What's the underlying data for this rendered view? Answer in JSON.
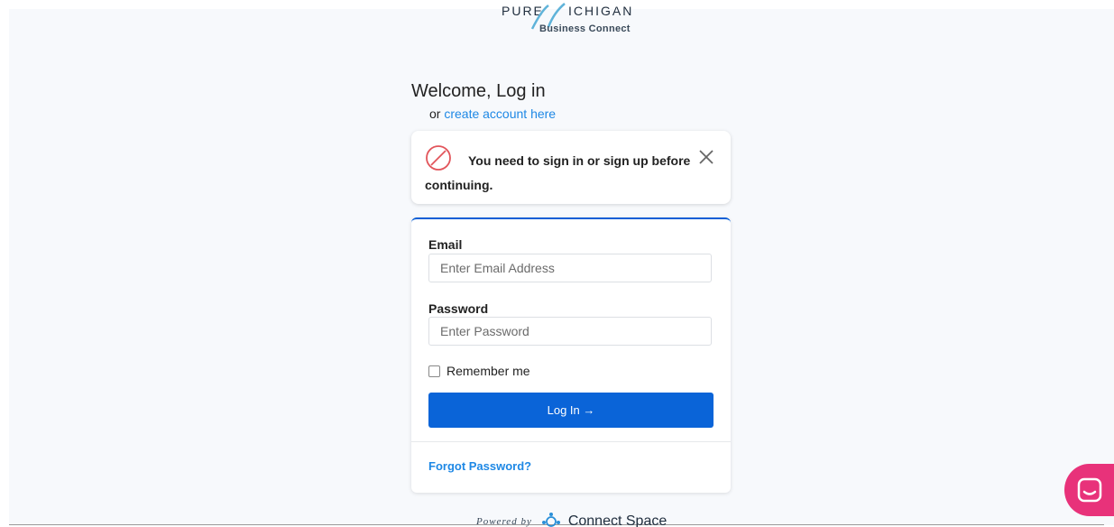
{
  "logo": {
    "word_left": "PURE",
    "word_right": "ICHIGAN",
    "tagline": "Business Connect"
  },
  "heading": {
    "title": "Welcome, Log in",
    "or_text": "or",
    "create_link": "create account here"
  },
  "alert": {
    "message": "You need to sign in or sign up before continuing."
  },
  "form": {
    "email_label": "Email",
    "email_placeholder": "Enter Email Address",
    "password_label": "Password",
    "password_placeholder": "Enter Password",
    "remember_label": "Remember me",
    "login_label": "Log In →",
    "forgot_label": "Forgot Password?"
  },
  "footer": {
    "powered_by": "Powered by",
    "brand": "Connect Space"
  },
  "icons": {
    "alert": "prohibited-icon",
    "close": "close-icon",
    "chat": "chat-icon"
  },
  "colors": {
    "primary": "#0a64d8",
    "link": "#1e88e5",
    "alert_icon": "#e2555b",
    "chat": "#e8327a"
  }
}
